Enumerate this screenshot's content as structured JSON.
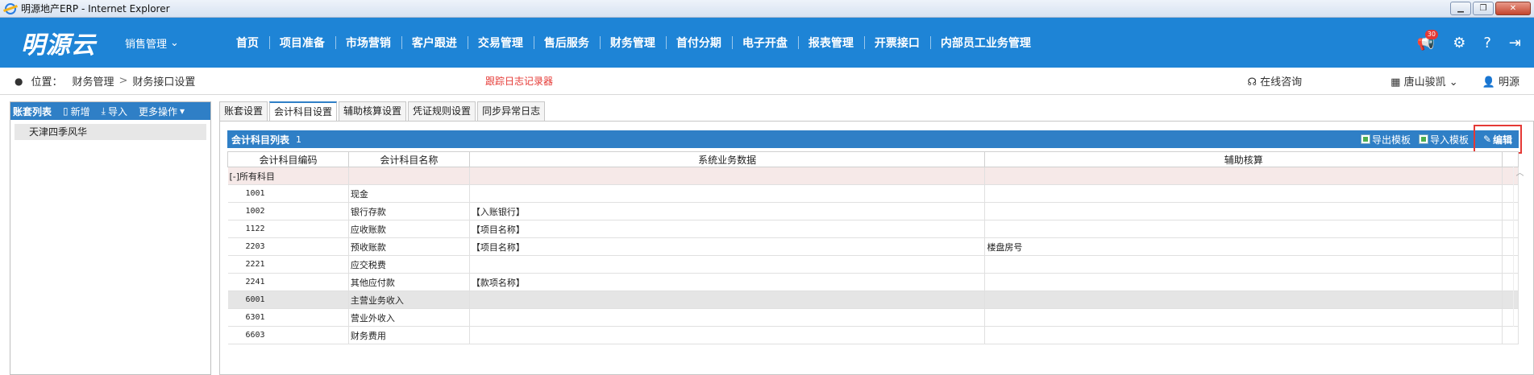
{
  "window": {
    "title": "明源地产ERP - Internet Explorer"
  },
  "topnav": {
    "logo": "明源云",
    "sales_menu": "销售管理",
    "items": [
      "首页",
      "项目准备",
      "市场营销",
      "客户跟进",
      "交易管理",
      "售后服务",
      "财务管理",
      "首付分期",
      "电子开盘",
      "报表管理",
      "开票接口",
      "内部员工业务管理"
    ],
    "badge": "30"
  },
  "breadcrumb": {
    "label": "位置：",
    "parts": [
      "财务管理",
      "财务接口设置"
    ],
    "log_link": "跟踪日志记录器",
    "consult": "在线咨询",
    "company": "唐山骏凯",
    "user": "明源"
  },
  "leftpanel": {
    "title": "账套列表",
    "new": "新增",
    "import": "导入",
    "more": "更多操作",
    "items": [
      "天津四季风华"
    ]
  },
  "tabs": [
    "账套设置",
    "会计科目设置",
    "辅助核算设置",
    "凭证规则设置",
    "同步异常日志"
  ],
  "grid": {
    "title": "会计科目列表",
    "count": "1",
    "export": "导出模板",
    "import": "导入模板",
    "edit": "编辑",
    "columns": [
      "会计科目编码",
      "会计科目名称",
      "系统业务数据",
      "辅助核算"
    ],
    "root": "[-]所有科目",
    "rows": [
      {
        "code": "1001",
        "name": "现金",
        "biz": "",
        "aux": ""
      },
      {
        "code": "1002",
        "name": "银行存款",
        "biz": "【入账银行】",
        "aux": ""
      },
      {
        "code": "1122",
        "name": "应收账款",
        "biz": "【项目名称】",
        "aux": ""
      },
      {
        "code": "2203",
        "name": "预收账款",
        "biz": "【项目名称】",
        "aux": "楼盘房号"
      },
      {
        "code": "2221",
        "name": "应交税费",
        "biz": "",
        "aux": ""
      },
      {
        "code": "2241",
        "name": "其他应付款",
        "biz": "【款项名称】",
        "aux": ""
      },
      {
        "code": "6001",
        "name": "主营业务收入",
        "biz": "",
        "aux": ""
      },
      {
        "code": "6301",
        "name": "营业外收入",
        "biz": "",
        "aux": ""
      },
      {
        "code": "6603",
        "name": "财务费用",
        "biz": "",
        "aux": ""
      }
    ]
  }
}
